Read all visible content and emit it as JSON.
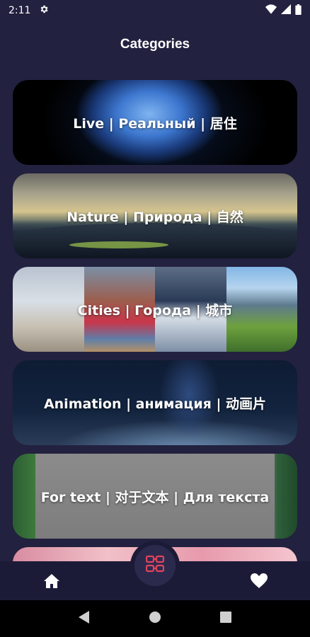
{
  "status_bar": {
    "time": "2:11",
    "icons": [
      "settings-gear-icon",
      "wifi-icon",
      "signal-icon",
      "battery-icon"
    ]
  },
  "page_title": "Categories",
  "categories": [
    {
      "label": "Live | Реальный | 居住"
    },
    {
      "label": "Nature | Природа | 自然"
    },
    {
      "label": "Cities | Города | 城市"
    },
    {
      "label": "Animation | анимация | 动画片"
    },
    {
      "label": "For text | 对于文本 | Для текста"
    }
  ],
  "bottom_nav": {
    "items": [
      "home-icon",
      "categories-icon",
      "heart-icon"
    ],
    "accent_color": "#e0435f"
  },
  "system_nav": [
    "back-icon",
    "home-circle-icon",
    "recents-icon"
  ]
}
